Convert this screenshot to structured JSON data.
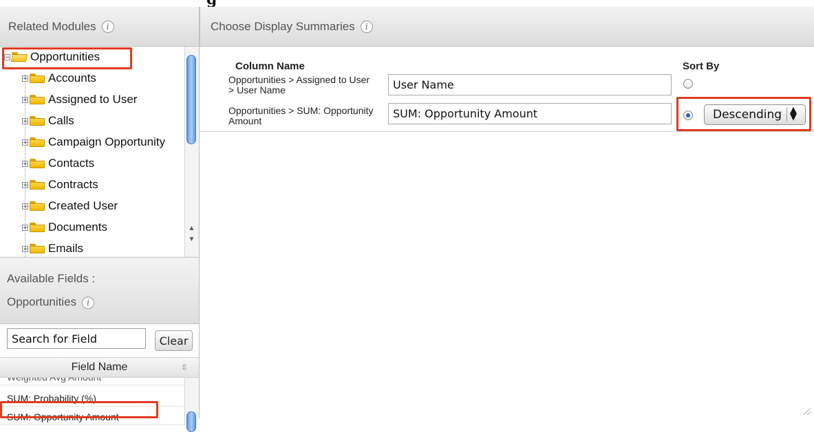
{
  "related_modules": {
    "title": "Related Modules",
    "tree": [
      {
        "label": "Opportunities",
        "expanded": true,
        "root": true
      },
      {
        "label": "Accounts"
      },
      {
        "label": "Assigned to User"
      },
      {
        "label": "Calls"
      },
      {
        "label": "Campaign Opportunity"
      },
      {
        "label": "Contacts"
      },
      {
        "label": "Contracts"
      },
      {
        "label": "Created User"
      },
      {
        "label": "Documents"
      },
      {
        "label": "Emails"
      }
    ]
  },
  "available_fields": {
    "title_line1": "Available Fields :",
    "title_line2": "Opportunities",
    "search_value": "Search for Field",
    "clear_label": "Clear",
    "column_header": "Field Name",
    "fields": [
      "Weighted Avg Amount",
      "SUM: Probability (%)",
      "SUM: Opportunity Amount"
    ]
  },
  "display_summaries": {
    "title": "Choose Display Summaries",
    "col_column_name": "Column Name",
    "col_sort_by": "Sort By",
    "rows": [
      {
        "label": "Opportunities > Assigned to User > User Name",
        "value": "User Name",
        "sort_selected": false
      },
      {
        "label": "Opportunities > SUM: Opportunity Amount",
        "value": "SUM: Opportunity Amount",
        "sort_selected": true
      }
    ],
    "sort_direction": "Descending"
  },
  "highlight_color": "#e23a20",
  "scroll_accent": "#5e9ae3"
}
